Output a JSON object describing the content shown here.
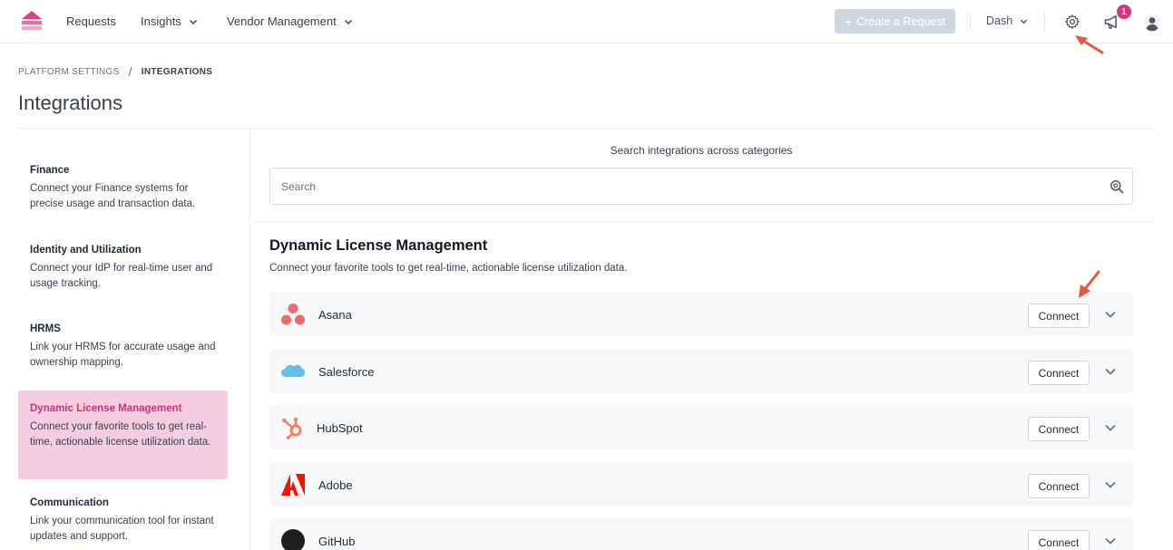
{
  "nav": {
    "items": [
      {
        "label": "Requests"
      },
      {
        "label": "Insights"
      },
      {
        "label": "Vendor Management"
      }
    ],
    "create_button": "Create a Request",
    "user_menu": "Dash",
    "notification_count": "1",
    "icons": [
      "logo",
      "chevron-down-icon",
      "gear-icon",
      "megaphone-icon",
      "user-avatar-icon"
    ]
  },
  "breadcrumb": {
    "parent": "PLATFORM SETTINGS",
    "separator": "/",
    "current": "INTEGRATIONS"
  },
  "page": {
    "title": "Integrations"
  },
  "sidebar": {
    "items": [
      {
        "title": "Finance",
        "desc": "Connect your Finance systems for precise usage and transaction data."
      },
      {
        "title": "Identity and Utilization",
        "desc": "Connect your IdP for real-time user and usage tracking."
      },
      {
        "title": "HRMS",
        "desc": "Link your HRMS for accurate usage and ownership mapping."
      },
      {
        "title": "Dynamic License Management",
        "desc": "Connect your favorite tools to get real-time, actionable license utilization data."
      },
      {
        "title": "Communication",
        "desc": "Link your communication tool for instant updates and support."
      }
    ],
    "active_index": 3
  },
  "search": {
    "caption": "Search integrations across categories",
    "placeholder": "Search",
    "value": ""
  },
  "section": {
    "title": "Dynamic License Management",
    "desc": "Connect your favorite tools to get real-time, actionable license utilization data."
  },
  "integrations": [
    {
      "name": "Asana",
      "action": "Connect"
    },
    {
      "name": "Salesforce",
      "action": "Connect"
    },
    {
      "name": "HubSpot",
      "action": "Connect"
    },
    {
      "name": "Adobe",
      "action": "Connect"
    },
    {
      "name": "GitHub",
      "action": "Connect"
    }
  ],
  "colors": {
    "accent": "#d6357f",
    "active_sidebar_bg": "#f5cde0",
    "active_sidebar_text": "#c8357a",
    "create_button_bg": "#cfd8e2",
    "row_bg": "#f7f8f9",
    "annotation_arrow": "#e8573d"
  }
}
